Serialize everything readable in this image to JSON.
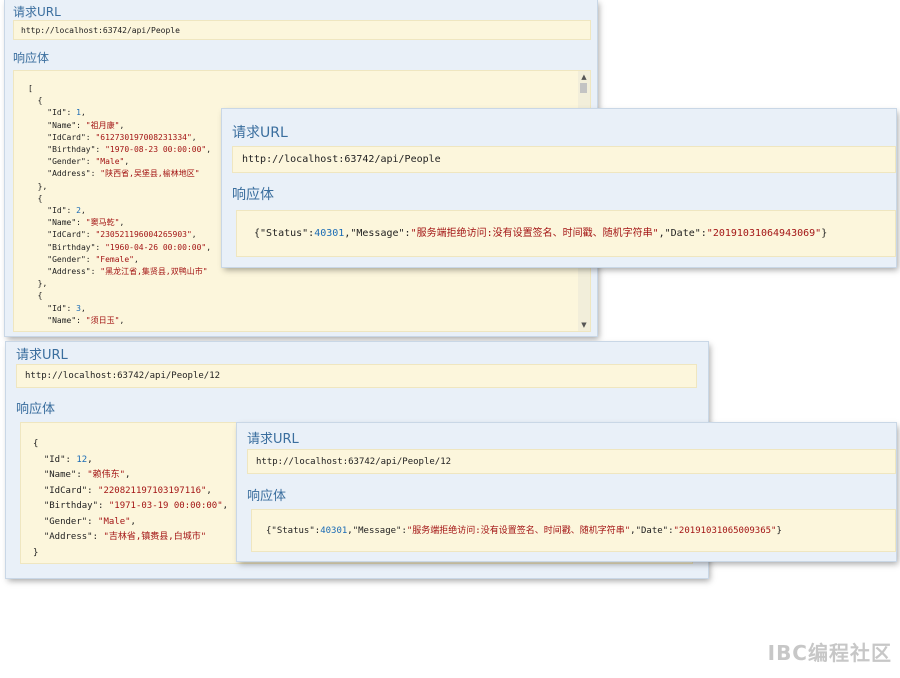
{
  "panel1": {
    "request_url_label": "请求URL",
    "url": "http://localhost:63742/api/People",
    "response_label": "响应体",
    "code_lines": [
      [
        [
          "k",
          "["
        ]
      ],
      [
        [
          "k",
          "  {"
        ]
      ],
      [
        [
          "k",
          "    \"Id\": "
        ],
        [
          "n",
          "1"
        ],
        [
          "k",
          ","
        ]
      ],
      [
        [
          "k",
          "    \"Name\": "
        ],
        [
          "s",
          "\"祖月康\""
        ],
        [
          "k",
          ","
        ]
      ],
      [
        [
          "k",
          "    \"IdCard\": "
        ],
        [
          "s",
          "\"612730197008231334\""
        ],
        [
          "k",
          ","
        ]
      ],
      [
        [
          "k",
          "    \"Birthday\": "
        ],
        [
          "s",
          "\"1970-08-23 00:00:00\""
        ],
        [
          "k",
          ","
        ]
      ],
      [
        [
          "k",
          "    \"Gender\": "
        ],
        [
          "s",
          "\"Male\""
        ],
        [
          "k",
          ","
        ]
      ],
      [
        [
          "k",
          "    \"Address\": "
        ],
        [
          "s",
          "\"陕西省,吴堡县,榆林地区\""
        ]
      ],
      [
        [
          "k",
          "  },"
        ]
      ],
      [
        [
          "k",
          "  {"
        ]
      ],
      [
        [
          "k",
          "    \"Id\": "
        ],
        [
          "n",
          "2"
        ],
        [
          "k",
          ","
        ]
      ],
      [
        [
          "k",
          "    \"Name\": "
        ],
        [
          "s",
          "\"窦马乾\""
        ],
        [
          "k",
          ","
        ]
      ],
      [
        [
          "k",
          "    \"IdCard\": "
        ],
        [
          "s",
          "\"230521196004265903\""
        ],
        [
          "k",
          ","
        ]
      ],
      [
        [
          "k",
          "    \"Birthday\": "
        ],
        [
          "s",
          "\"1960-04-26 00:00:00\""
        ],
        [
          "k",
          ","
        ]
      ],
      [
        [
          "k",
          "    \"Gender\": "
        ],
        [
          "s",
          "\"Female\""
        ],
        [
          "k",
          ","
        ]
      ],
      [
        [
          "k",
          "    \"Address\": "
        ],
        [
          "s",
          "\"黑龙江省,集贤县,双鸭山市\""
        ]
      ],
      [
        [
          "k",
          "  },"
        ]
      ],
      [
        [
          "k",
          "  {"
        ]
      ],
      [
        [
          "k",
          "    \"Id\": "
        ],
        [
          "n",
          "3"
        ],
        [
          "k",
          ","
        ]
      ],
      [
        [
          "k",
          "    \"Name\": "
        ],
        [
          "s",
          "\"须日玉\""
        ],
        [
          "k",
          ","
        ]
      ]
    ]
  },
  "panel2": {
    "request_url_label": "请求URL",
    "url": "http://localhost:63742/api/People",
    "response_label": "响应体",
    "code_lines": [
      [
        [
          "k",
          "{\"Status\":"
        ],
        [
          "n",
          "40301"
        ],
        [
          "k",
          ",\"Message\":"
        ],
        [
          "s",
          "\"服务端拒绝访问:没有设置签名、时间戳、随机字符串\""
        ],
        [
          "k",
          ",\"Date\":"
        ],
        [
          "s",
          "\"20191031064943069\""
        ],
        [
          "k",
          "}"
        ]
      ]
    ]
  },
  "panel3": {
    "request_url_label": "请求URL",
    "url": "http://localhost:63742/api/People/12",
    "response_label": "响应体",
    "code_lines": [
      [
        [
          "k",
          "{"
        ]
      ],
      [
        [
          "k",
          "  \"Id\": "
        ],
        [
          "n",
          "12"
        ],
        [
          "k",
          ","
        ]
      ],
      [
        [
          "k",
          "  \"Name\": "
        ],
        [
          "s",
          "\"赖伟东\""
        ],
        [
          "k",
          ","
        ]
      ],
      [
        [
          "k",
          "  \"IdCard\": "
        ],
        [
          "s",
          "\"220821197103197116\""
        ],
        [
          "k",
          ","
        ]
      ],
      [
        [
          "k",
          "  \"Birthday\": "
        ],
        [
          "s",
          "\"1971-03-19 00:00:00\""
        ],
        [
          "k",
          ","
        ]
      ],
      [
        [
          "k",
          "  \"Gender\": "
        ],
        [
          "s",
          "\"Male\""
        ],
        [
          "k",
          ","
        ]
      ],
      [
        [
          "k",
          "  \"Address\": "
        ],
        [
          "s",
          "\"吉林省,镇赉县,白城市\""
        ]
      ],
      [
        [
          "k",
          "}"
        ]
      ]
    ]
  },
  "panel4": {
    "request_url_label": "请求URL",
    "url": "http://localhost:63742/api/People/12",
    "response_label": "响应体",
    "code_lines": [
      [
        [
          "k",
          "{\"Status\":"
        ],
        [
          "n",
          "40301"
        ],
        [
          "k",
          ",\"Message\":"
        ],
        [
          "s",
          "\"服务端拒绝访问:没有设置签名、时间戳、随机字符串\""
        ],
        [
          "k",
          ",\"Date\":"
        ],
        [
          "s",
          "\"20191031065009365\""
        ],
        [
          "k",
          "}"
        ]
      ]
    ]
  },
  "watermark": "IBC编程社区",
  "colors": {
    "panel_bg": "#e9f0f8",
    "code_bg": "#fcf6dc",
    "label": "#3a6e9e",
    "string": "#a31515",
    "number": "#1a6bb5"
  }
}
